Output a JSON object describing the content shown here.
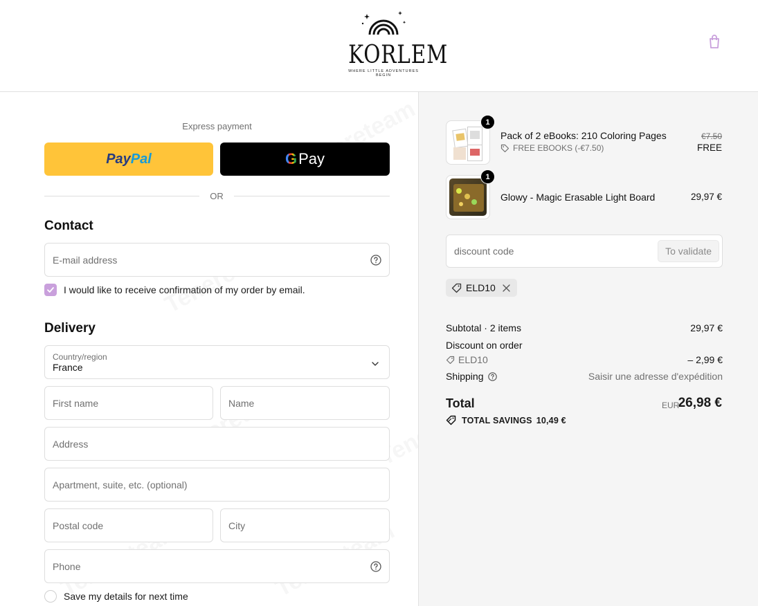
{
  "header": {
    "brand": "KORLEM",
    "tagline": "WHERE LITTLE ADVENTURES BEGIN",
    "cart_icon": "shopping-bag-icon"
  },
  "express": {
    "label": "Express payment",
    "paypal_part1": "Pay",
    "paypal_part2": "Pal",
    "gpay_g": "G",
    "gpay_text": "Pay",
    "or": "OR"
  },
  "contact": {
    "title": "Contact",
    "email_placeholder": "E-mail address",
    "email_optin_label": "I would like to receive confirmation of my order by email.",
    "email_optin_checked": true
  },
  "delivery": {
    "title": "Delivery",
    "country_label": "Country/region",
    "country_value": "France",
    "first_name_placeholder": "First name",
    "last_name_placeholder": "Name",
    "address_placeholder": "Address",
    "apartment_placeholder": "Apartment, suite, etc. (optional)",
    "postal_placeholder": "Postal code",
    "city_placeholder": "City",
    "phone_placeholder": "Phone",
    "save_label": "Save my details for next time"
  },
  "cart": {
    "items": [
      {
        "quantity": "1",
        "name": "Pack of 2 eBooks: 210 Coloring Pages",
        "discount_label": "FREE EBOOKS (-€7.50)",
        "original_price": "€7.50",
        "price": "FREE"
      },
      {
        "quantity": "1",
        "name": "Glowy - Magic Erasable Light Board",
        "price": "29,97 €"
      }
    ],
    "discount_placeholder": "discount code",
    "validate_label": "To validate",
    "applied_code": "ELD10"
  },
  "summary": {
    "subtotal_label": "Subtotal · 2 items",
    "subtotal_value": "29,97 €",
    "discount_label": "Discount on order",
    "discount_code": "ELD10",
    "discount_value": "– 2,99 €",
    "shipping_label": "Shipping",
    "shipping_value": "Saisir une adresse d'expédition",
    "total_label": "Total",
    "total_currency": "EUR",
    "total_value": "26,98 €",
    "savings_label": "TOTAL SAVINGS",
    "savings_value": "10,49 €"
  },
  "colors": {
    "accent_checkbox": "#c9a0dc",
    "paypal_yellow": "#ffc439",
    "gpay_black": "#000000",
    "summary_bg": "#f5f5f5"
  }
}
